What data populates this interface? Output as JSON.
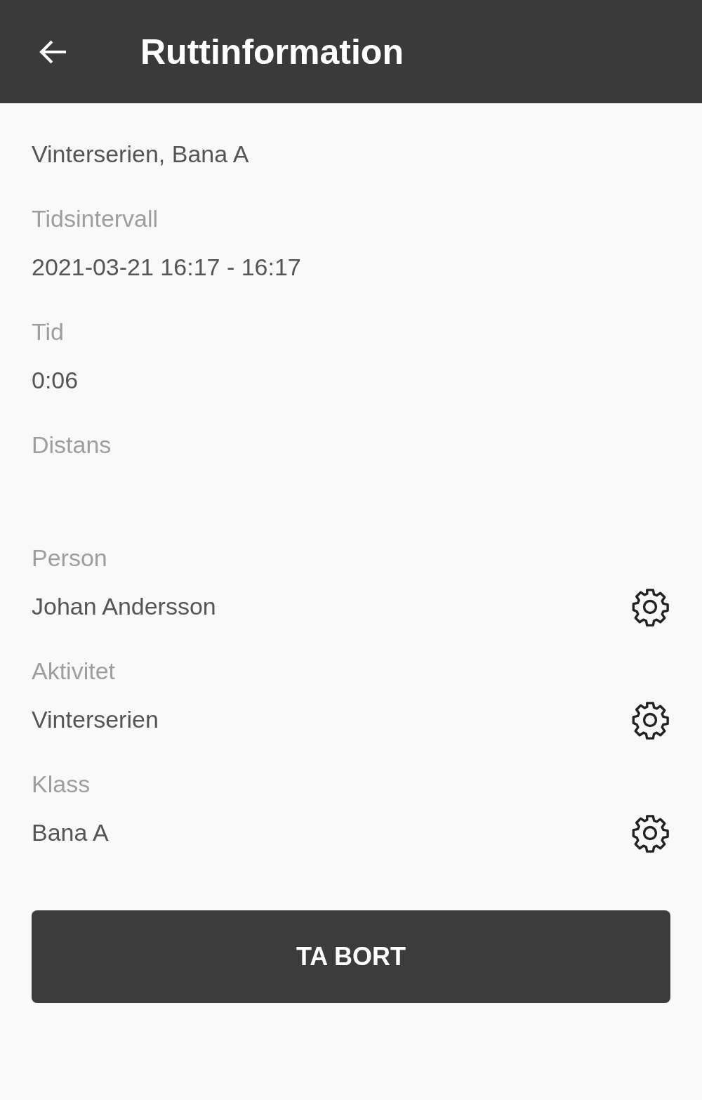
{
  "app_bar": {
    "title": "Ruttinformation"
  },
  "heading": "Vinterserien, Bana A",
  "fields": [
    {
      "label": "Tidsintervall",
      "value": "2021-03-21 16:17 - 16:17",
      "kind": "plain"
    },
    {
      "label": "Tid",
      "value": "0:06",
      "kind": "plain"
    },
    {
      "label": "Distans",
      "kind": "plain"
    },
    {
      "label": "Person",
      "value": "Johan Andersson",
      "kind": "setting"
    },
    {
      "label": "Aktivitet",
      "value": "Vinterserien",
      "kind": "setting"
    },
    {
      "label": "Klass",
      "value": "Bana A",
      "kind": "setting"
    }
  ],
  "button": {
    "label": "TA BORT"
  }
}
